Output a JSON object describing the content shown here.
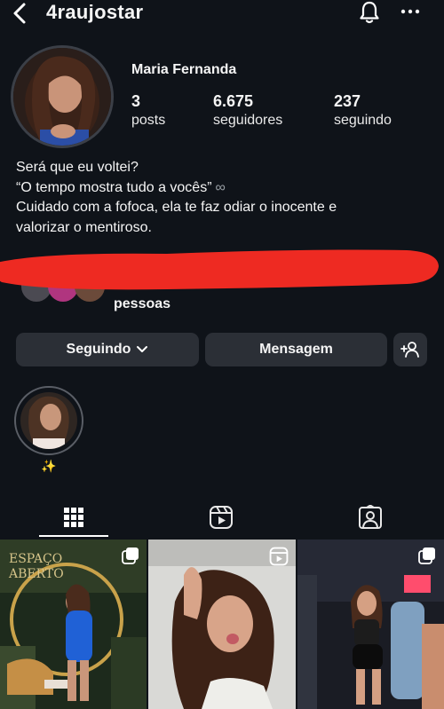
{
  "header": {
    "username": "4raujostar",
    "back_icon": "chevron-left-icon",
    "bell_icon": "bell-icon",
    "more_icon": "more-horizontal-icon"
  },
  "profile": {
    "display_name": "Maria Fernanda",
    "stats": [
      {
        "value": "3",
        "label": "posts"
      },
      {
        "value": "6.675",
        "label": "seguidores"
      },
      {
        "value": "237",
        "label": "seguindo"
      }
    ],
    "bio": [
      "Será que eu voltei?",
      "“O tempo mostra tudo a vocês”",
      "Cuidado com a fofoca, ela te faz odiar o inocente e",
      "valorizar o mentiroso."
    ],
    "bio_symbol": "∞",
    "followed_by_text": "pessoas"
  },
  "actions": {
    "following_label": "Seguindo",
    "message_label": "Mensagem",
    "add_person_icon": "add-person-icon"
  },
  "highlights": [
    {
      "label": "✨"
    }
  ],
  "tabs": [
    {
      "icon": "grid-icon",
      "active": true
    },
    {
      "icon": "reels-icon",
      "active": false
    },
    {
      "icon": "tagged-icon",
      "active": false
    }
  ],
  "posts": [
    {
      "badge_icon": "carousel-icon",
      "sign_text": "ESPAÇO ABERTO"
    },
    {
      "badge_icon": "reels-icon"
    },
    {
      "badge_icon": "carousel-icon"
    }
  ],
  "colors": {
    "background": "#0f1319",
    "button": "#2b2f36",
    "redaction": "#ee2a22"
  }
}
